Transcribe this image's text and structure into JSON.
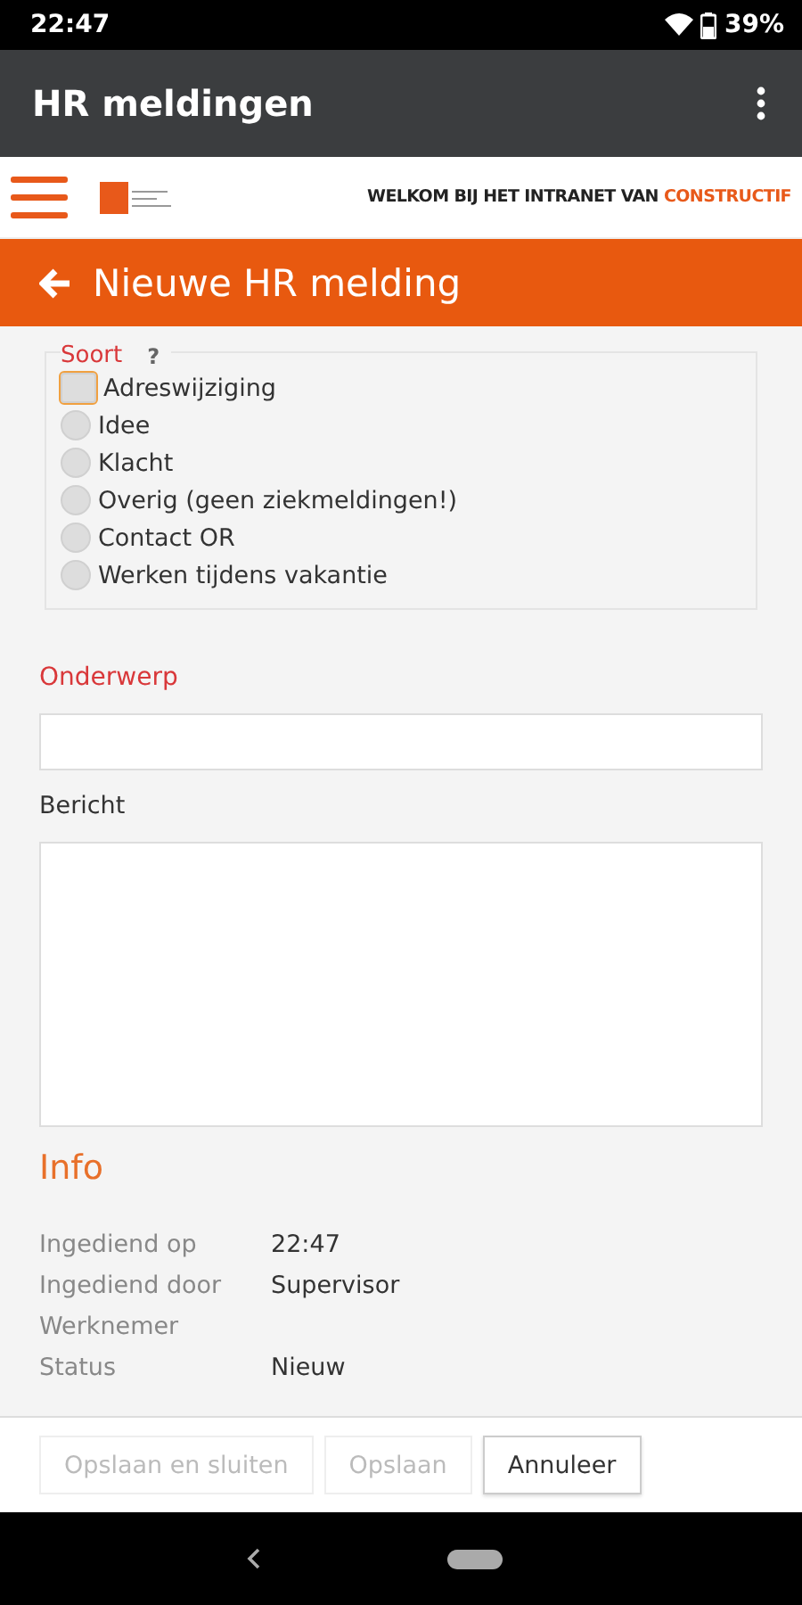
{
  "status_bar": {
    "time": "22:47",
    "battery": "39%"
  },
  "app_bar": {
    "title": "HR meldingen"
  },
  "site_header": {
    "welcome": "WELKOM BIJ HET INTRANET VAN",
    "brand": "CONSTRUCTIF"
  },
  "page_title": "Nieuwe HR melding",
  "soort": {
    "label": "Soort",
    "help": "?",
    "options": [
      {
        "label": "Adreswijziging",
        "selected": false,
        "focused": true
      },
      {
        "label": "Idee",
        "selected": false,
        "focused": false
      },
      {
        "label": "Klacht",
        "selected": false,
        "focused": false
      },
      {
        "label": "Overig (geen ziekmeldingen!)",
        "selected": false,
        "focused": false
      },
      {
        "label": "Contact OR",
        "selected": false,
        "focused": false
      },
      {
        "label": "Werken tijdens vakantie",
        "selected": false,
        "focused": false
      }
    ]
  },
  "onderwerp": {
    "label": "Onderwerp"
  },
  "bericht": {
    "label": "Bericht"
  },
  "info": {
    "title": "Info",
    "rows": [
      {
        "label": "Ingediend op",
        "value": "22:47"
      },
      {
        "label": "Ingediend door",
        "value": "Supervisor"
      },
      {
        "label": "Werknemer"
      },
      {
        "label": "Status",
        "value": "Nieuw"
      }
    ]
  },
  "buttons": [
    {
      "label": "Opslaan en sluiten",
      "disabled": true
    },
    {
      "label": "Opslaan",
      "disabled": true
    },
    {
      "label": "Annuleer",
      "disabled": false
    }
  ]
}
